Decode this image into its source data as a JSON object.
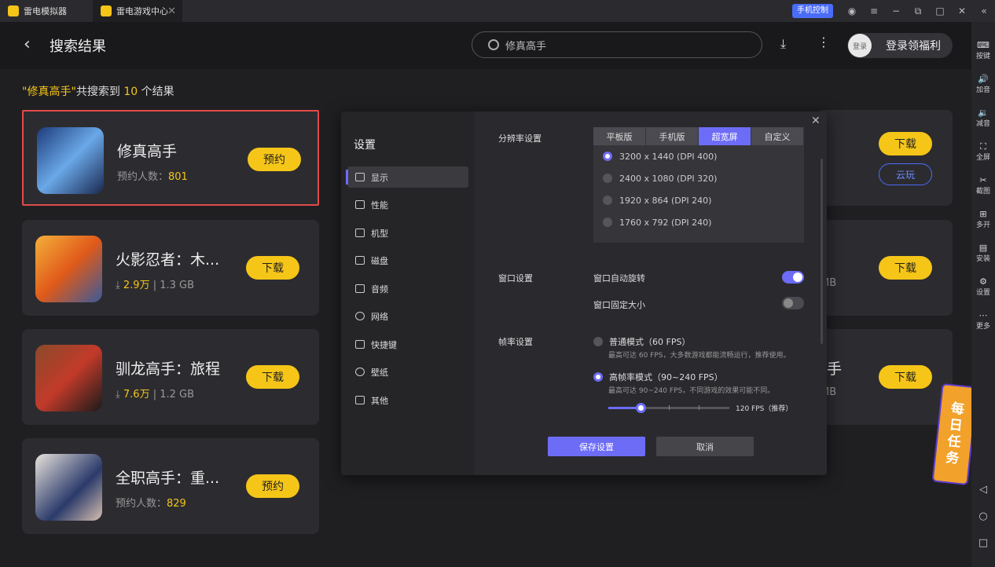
{
  "titlebar": {
    "app_tab": "雷电模拟器",
    "game_tab": "雷电游戏中心",
    "phone_control": "手机控制"
  },
  "header": {
    "title": "搜索结果",
    "search_value": "修真高手",
    "login_avatar": "登录",
    "login_label": "登录领福利"
  },
  "summary": {
    "q_open": "\"",
    "query": "修真高手",
    "q_close": "\"",
    "text1": "共搜索到 ",
    "count": "10",
    "text2": " 个结果"
  },
  "results": [
    {
      "name": "修真高手",
      "meta_label": "预约人数：",
      "meta_value": "801",
      "size": "",
      "button": "预约"
    },
    {
      "name": "火影忍者：木...",
      "meta_label": "",
      "meta_value": "2.9万",
      "size": "1.3 GB",
      "button": "下载"
    },
    {
      "name": "驯龙高手：旅程",
      "meta_label": "",
      "meta_value": "7.6万",
      "size": "1.2 GB",
      "button": "下载"
    },
    {
      "name": "全职高手：重...",
      "meta_label": "预约人数：",
      "meta_value": "829",
      "size": "",
      "button": "预约"
    }
  ],
  "right_col": {
    "btn1": "下载",
    "cloud": "云玩",
    "frag1": "B",
    "btn2": "下载",
    "frag2": "MB",
    "frag3_title": "手",
    "frag3": "MB",
    "btn3": "下载"
  },
  "daily_task": [
    "每",
    "日",
    "任",
    "务"
  ],
  "sidebar": [
    "按键",
    "加音",
    "减音",
    "全屏",
    "截图",
    "多开",
    "安装",
    "设置",
    "更多"
  ],
  "settings": {
    "title": "设置",
    "nav": [
      "显示",
      "性能",
      "机型",
      "磁盘",
      "音频",
      "网络",
      "快捷键",
      "壁纸",
      "其他"
    ],
    "resolution_label": "分辨率设置",
    "tabs": [
      "平板版",
      "手机版",
      "超宽屏",
      "自定义"
    ],
    "resolutions": [
      "3200 x 1440  (DPI 400)",
      "2400 x 1080  (DPI 320)",
      "1920 x 864  (DPI 240)",
      "1760 x 792  (DPI 240)"
    ],
    "window_label": "窗口设置",
    "auto_rotate": "窗口自动旋转",
    "fixed_size": "窗口固定大小",
    "fps_label": "帧率设置",
    "normal_mode": "普通模式（60 FPS）",
    "normal_desc": "最高可达 60 FPS，大多数游戏都能流畅运行，推荐使用。",
    "high_mode": "高帧率模式（90~240 FPS）",
    "high_desc": "最高可达 90~240 FPS，不同游戏的效果可能不同。",
    "fps_value": "120 FPS（推荐）",
    "save": "保存设置",
    "cancel": "取消"
  }
}
